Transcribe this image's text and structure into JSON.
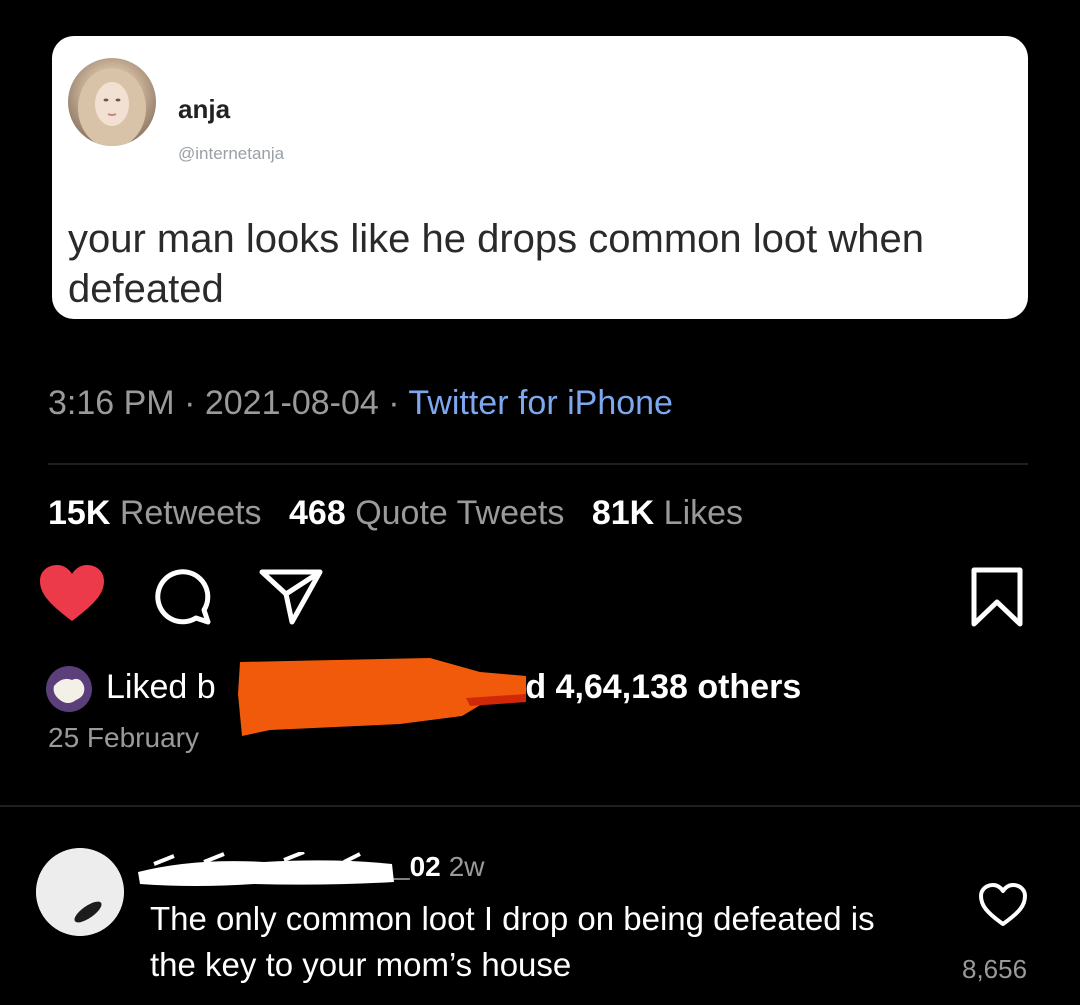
{
  "tweet": {
    "name": "anja",
    "handle": "@internetanja",
    "text": "your man looks like he drops common loot when defeated",
    "time": "3:16 PM",
    "date": "2021-08-04",
    "source": "Twitter for iPhone",
    "stats": {
      "retweets_count": "15K",
      "retweets_label": "Retweets",
      "quotes_count": "468",
      "quotes_label": "Quote Tweets",
      "likes_count": "81K",
      "likes_label": "Likes"
    }
  },
  "post": {
    "liked_prefix": "Liked b",
    "liked_suffix": "and 4,64,138 others",
    "date": "25 February",
    "colors": {
      "like": "#ed3a4a",
      "redaction": "#f05a0a"
    }
  },
  "comment": {
    "username_visible": "_02",
    "time_ago": "2w",
    "text": "The only common loot I drop on being defeated is the key to your mom’s house",
    "likes": "8,656"
  },
  "icons": [
    "heart-icon",
    "comment-icon",
    "share-icon",
    "save-icon",
    "heart-outline-icon"
  ]
}
